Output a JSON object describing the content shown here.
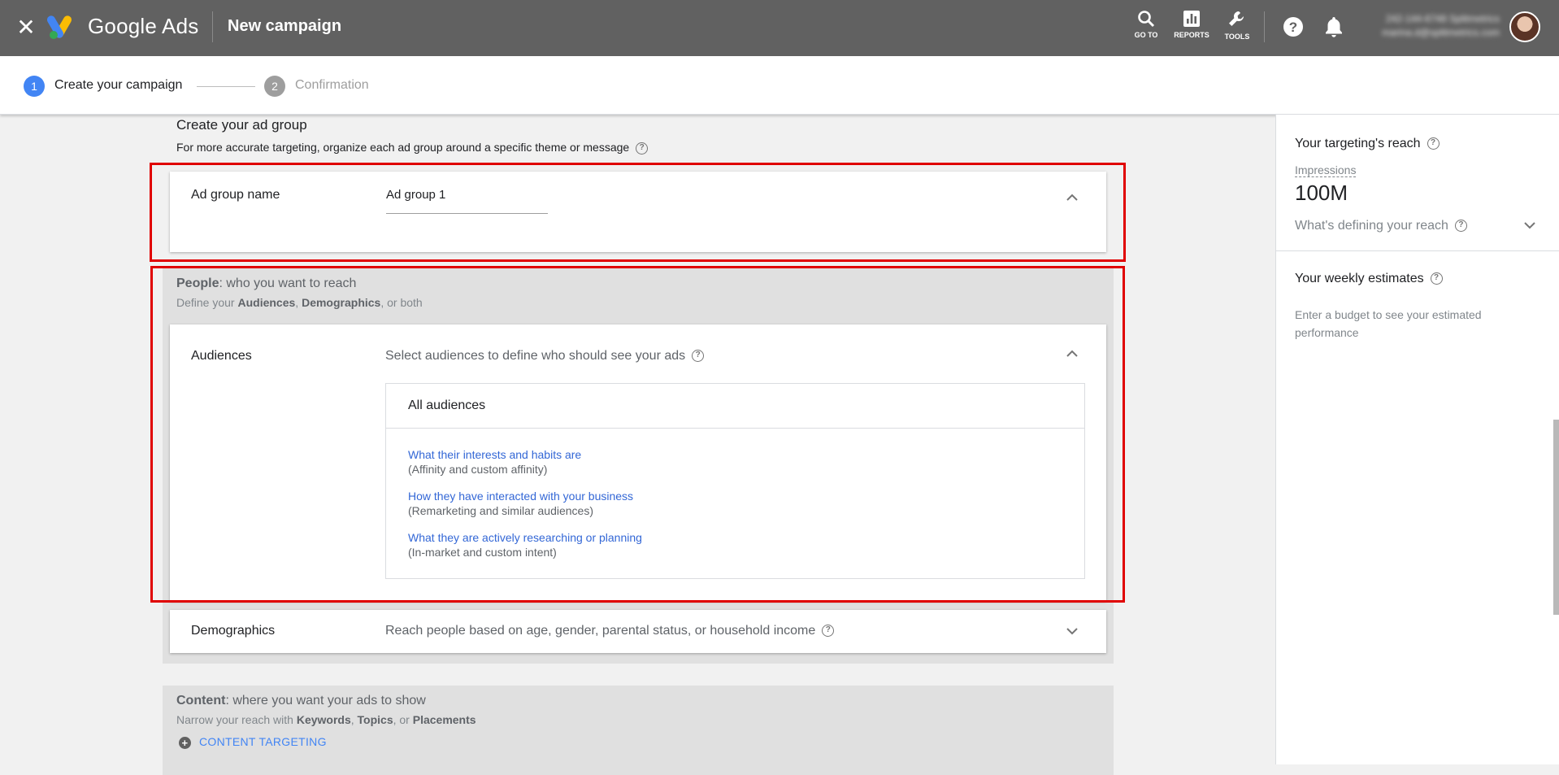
{
  "header": {
    "product_name": "Google Ads",
    "page_title": "New campaign",
    "tools": [
      {
        "label": "GO TO",
        "icon": "search-icon"
      },
      {
        "label": "REPORTS",
        "icon": "reports-icon"
      },
      {
        "label": "TOOLS",
        "icon": "wrench-icon"
      }
    ],
    "account_id": "242-144-6748 Splitmetrics",
    "account_email": "marina.d@splitmetrics.com"
  },
  "stepper": {
    "steps": [
      {
        "number": "1",
        "label": "Create your campaign"
      },
      {
        "number": "2",
        "label": "Confirmation"
      }
    ]
  },
  "ad_group": {
    "title": "Create your ad group",
    "description": "For more accurate targeting, organize each ad group around a specific theme or message",
    "name_label": "Ad group name",
    "name_value": "Ad group 1"
  },
  "people": {
    "title_bold": "People",
    "title_rest": ": who you want to reach",
    "desc_prefix": "Define your ",
    "desc_audiences": "Audiences",
    "desc_sep": ", ",
    "desc_demographics": "Demographics",
    "desc_suffix": ", or both",
    "audiences": {
      "label": "Audiences",
      "hint": "Select audiences to define who should see your ads",
      "box_title": "All audiences",
      "items": [
        {
          "link": "What their interests and habits are",
          "sub": "(Affinity and custom affinity)"
        },
        {
          "link": "How they have interacted with your business",
          "sub": "(Remarketing and similar audiences)"
        },
        {
          "link": "What they are actively researching or planning",
          "sub": "(In-market and custom intent)"
        }
      ]
    },
    "demographics": {
      "label": "Demographics",
      "hint": "Reach people based on age, gender, parental status, or household income"
    }
  },
  "content": {
    "title_bold": "Content",
    "title_rest": ": where you want your ads to show",
    "desc_prefix": "Narrow your reach with ",
    "desc_keywords": "Keywords",
    "desc_sep": ", ",
    "desc_topics": "Topics",
    "desc_or": ", or ",
    "desc_placements": "Placements",
    "button_label": "CONTENT TARGETING"
  },
  "sidebar": {
    "reach_title": "Your targeting's reach",
    "impressions_label": "Impressions",
    "impressions_value": "100M",
    "defining_label": "What's defining your reach",
    "weekly_title": "Your weekly estimates",
    "weekly_note": "Enter a budget to see your estimated performance"
  },
  "colors": {
    "topbar": "#616161",
    "accent": "#4285f4",
    "link": "#3367d6",
    "highlight": "#e00000"
  }
}
